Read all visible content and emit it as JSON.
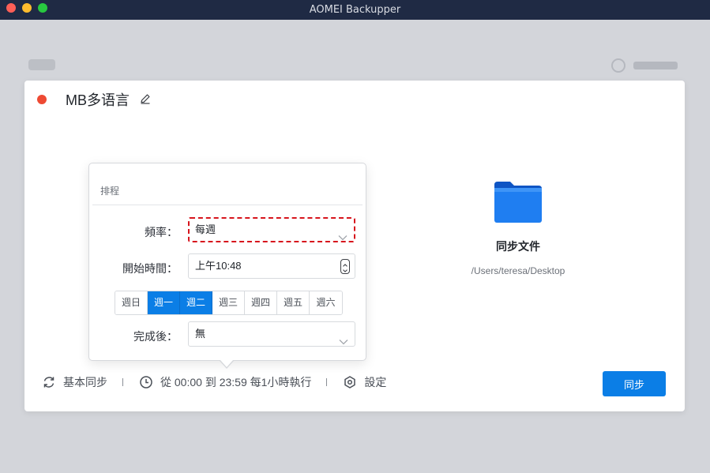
{
  "window": {
    "title": "AOMEI Backupper"
  },
  "task": {
    "name": "MB多语言",
    "destination": {
      "label": "同步文件",
      "path": "/Users/teresa/Desktop"
    }
  },
  "schedule": {
    "header": "排程",
    "frequency": {
      "label": "頻率：",
      "value": "每週"
    },
    "start_time": {
      "label": "開始時間：",
      "value": "上午10:48"
    },
    "weekdays": [
      {
        "label": "週日",
        "selected": false
      },
      {
        "label": "週一",
        "selected": true
      },
      {
        "label": "週二",
        "selected": true
      },
      {
        "label": "週三",
        "selected": false
      },
      {
        "label": "週四",
        "selected": false
      },
      {
        "label": "週五",
        "selected": false
      },
      {
        "label": "週六",
        "selected": false
      }
    ],
    "after_done": {
      "label": "完成後：",
      "value": "無"
    }
  },
  "footer": {
    "mode": "基本同步",
    "schedule_summary": "從 00:00 到 23:59 每1小時執行",
    "settings": "設定",
    "sync_button": "同步"
  },
  "colors": {
    "accent": "#0b7ee6",
    "status_dot": "#ee4a33",
    "highlight_border": "#d7151d"
  }
}
